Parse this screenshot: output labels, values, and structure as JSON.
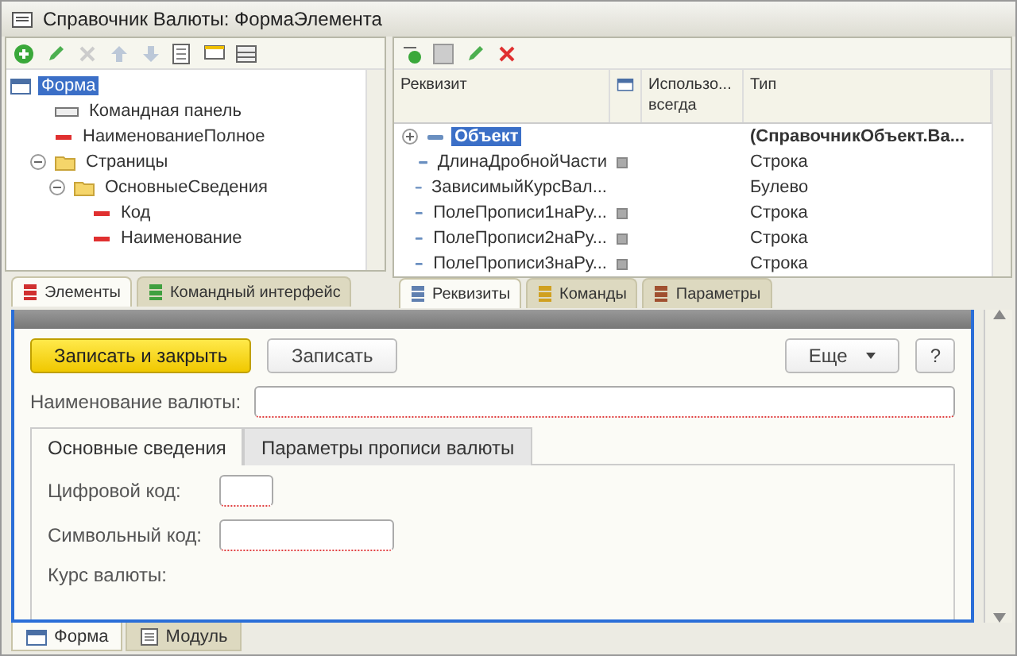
{
  "window": {
    "title": "Справочник Валюты: ФормаЭлемента"
  },
  "tree": [
    {
      "label": "Форма",
      "kind": "form",
      "selected": true,
      "children": [
        {
          "label": "Командная панель",
          "kind": "panel",
          "selected": false
        },
        {
          "label": "НаименованиеПолное",
          "kind": "field",
          "selected": false
        },
        {
          "label": "Страницы",
          "kind": "group",
          "selected": false,
          "expanded": true,
          "children": [
            {
              "label": "ОсновныеСведения",
              "kind": "group",
              "selected": false,
              "expanded": true,
              "children": [
                {
                  "label": "Код",
                  "kind": "field",
                  "selected": false
                },
                {
                  "label": "Наименование",
                  "kind": "field",
                  "selected": false
                }
              ]
            }
          ]
        }
      ]
    }
  ],
  "left_tabs": [
    {
      "label": "Элементы",
      "selected": true,
      "color": "#d03030"
    },
    {
      "label": "Командный интерфейс",
      "selected": false,
      "color": "#40a040"
    }
  ],
  "attributes": {
    "columns": [
      "Реквизит",
      "Использо... всегда",
      "Тип"
    ],
    "rows": [
      {
        "name": "Объект",
        "selected": true,
        "expandable": true,
        "marked": false,
        "type": "(СправочникОбъект.Ва..."
      },
      {
        "name": "ДлинаДробнойЧасти",
        "selected": false,
        "expandable": false,
        "marked": true,
        "type": "Строка"
      },
      {
        "name": "ЗависимыйКурсВал...",
        "selected": false,
        "expandable": false,
        "marked": false,
        "type": "Булево"
      },
      {
        "name": "ПолеПрописи1наРу...",
        "selected": false,
        "expandable": false,
        "marked": true,
        "type": "Строка"
      },
      {
        "name": "ПолеПрописи2наРу...",
        "selected": false,
        "expandable": false,
        "marked": true,
        "type": "Строка"
      },
      {
        "name": "ПолеПрописи3наРу...",
        "selected": false,
        "expandable": false,
        "marked": true,
        "type": "Строка"
      }
    ]
  },
  "right_tabs": [
    {
      "label": "Реквизиты",
      "selected": true,
      "color": "#6080b0"
    },
    {
      "label": "Команды",
      "selected": false,
      "color": "#d0a020"
    },
    {
      "label": "Параметры",
      "selected": false,
      "color": "#a05030"
    }
  ],
  "form": {
    "buttons": [
      {
        "label": "Записать и закрыть",
        "kind": "primary"
      },
      {
        "label": "Записать",
        "kind": "normal"
      },
      {
        "label": "Еще",
        "kind": "menu"
      },
      {
        "label": "?",
        "kind": "help"
      }
    ],
    "name_field": {
      "label": "Наименование валюты:"
    },
    "page_tabs": [
      {
        "label": "Основные сведения",
        "selected": true
      },
      {
        "label": "Параметры прописи валюты",
        "selected": false
      }
    ],
    "fields": [
      {
        "label": "Цифровой код:",
        "kind": "short"
      },
      {
        "label": "Символьный код:",
        "kind": "medium"
      },
      {
        "label": "Курс валюты:",
        "kind": "caption"
      }
    ]
  },
  "bottom_tabs": [
    {
      "label": "Форма",
      "selected": true
    },
    {
      "label": "Модуль",
      "selected": false
    }
  ]
}
